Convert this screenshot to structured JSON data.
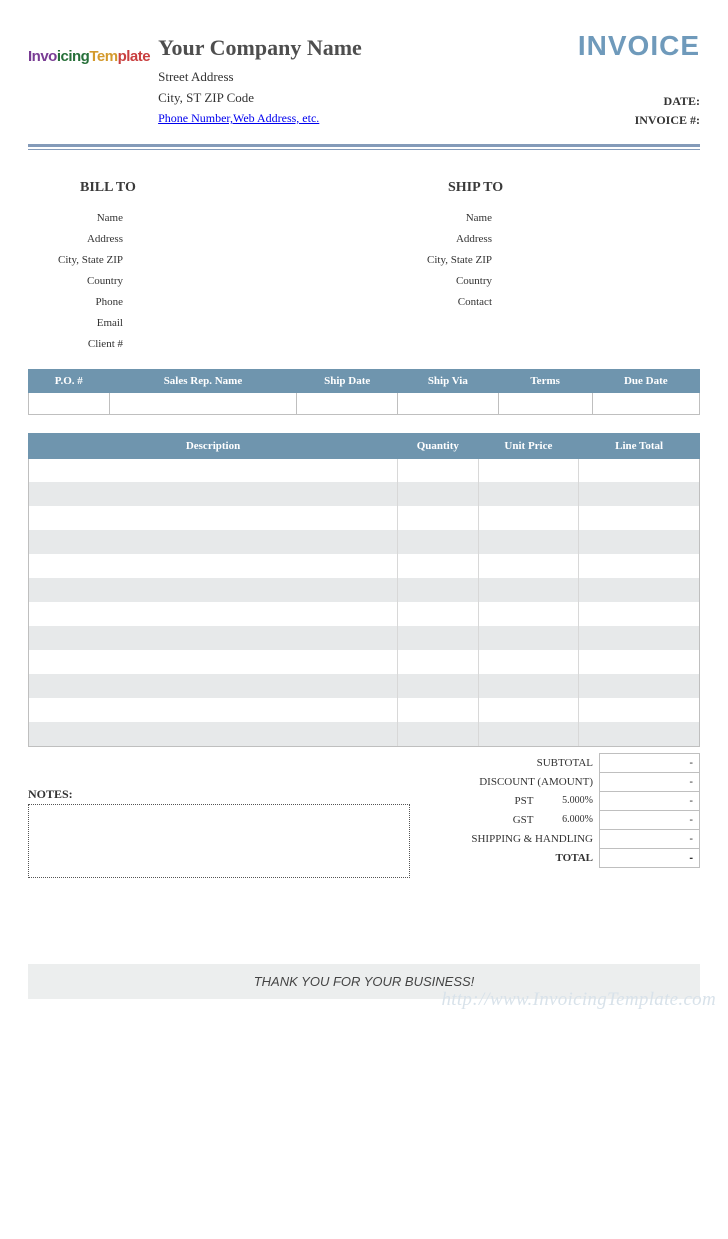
{
  "header": {
    "logo_text": "InvoicingTemplate",
    "company_name": "Your Company Name",
    "street": "Street Address",
    "city_line": "City, ST  ZIP Code",
    "contact_link": "Phone Number,Web Address, etc.",
    "title": "INVOICE",
    "meta_date_label": "DATE:",
    "meta_invoice_label": "INVOICE #:"
  },
  "billto": {
    "head": "BILL TO",
    "labels": [
      "Name",
      "Address",
      "City, State ZIP",
      "Country",
      "Phone",
      "Email",
      "Client #"
    ]
  },
  "shipto": {
    "head": "SHIP TO",
    "labels": [
      "Name",
      "Address",
      "City, State ZIP",
      "Country",
      "Contact"
    ]
  },
  "po_cols": [
    "P.O. #",
    "Sales Rep. Name",
    "Ship Date",
    "Ship Via",
    "Terms",
    "Due Date"
  ],
  "items_cols": [
    "Description",
    "Quantity",
    "Unit Price",
    "Line Total"
  ],
  "items_row_count": 12,
  "totals": {
    "subtotal_label": "SUBTOTAL",
    "discount_label": "DISCOUNT (AMOUNT)",
    "pst_label": "PST",
    "pst_rate": "5.000%",
    "gst_label": "GST",
    "gst_rate": "6.000%",
    "ship_label": "SHIPPING & HANDLING",
    "total_label": "TOTAL",
    "dash": "-"
  },
  "notes_label": "NOTES:",
  "thankyou": "THANK YOU FOR YOUR BUSINESS!",
  "watermark": "http://www.InvoicingTemplate.com"
}
